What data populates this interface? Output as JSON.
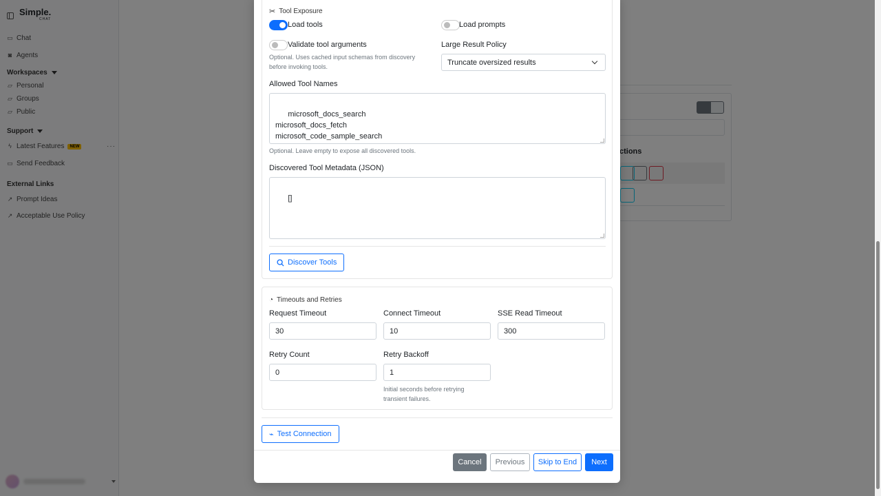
{
  "sidebar": {
    "brand": "Simple.",
    "brand_sub": "CHAT",
    "items": {
      "chat": "Chat",
      "agents": "Agents",
      "workspaces": "Workspaces",
      "personal": "Personal",
      "groups": "Groups",
      "public": "Public",
      "support": "Support",
      "latest_features": "Latest Features",
      "new_badge": "NEW",
      "send_feedback": "Send Feedback",
      "external_links": "External Links",
      "prompt_ideas": "Prompt Ideas",
      "acceptable_use": "Acceptable Use Policy"
    }
  },
  "background": {
    "actions_heading": "ctions"
  },
  "modal": {
    "tool_exposure": {
      "title": "Tool Exposure",
      "load_tools": {
        "label": "Load tools",
        "checked": true
      },
      "load_prompts": {
        "label": "Load prompts",
        "checked": false
      },
      "validate_args": {
        "label": "Validate tool arguments",
        "checked": false
      },
      "validate_help": "Optional. Uses cached input schemas from discovery before invoking tools.",
      "large_result_label": "Large Result Policy",
      "large_result_value": "Truncate oversized results",
      "allowed_label": "Allowed Tool Names",
      "allowed_value": "microsoft_docs_search\nmicrosoft_docs_fetch\nmicrosoft_code_sample_search",
      "allowed_help": "Optional. Leave empty to expose all discovered tools.",
      "metadata_label": "Discovered Tool Metadata (JSON)",
      "metadata_value": "[]",
      "discover_button": "Discover Tools"
    },
    "timeouts": {
      "title": "Timeouts and Retries",
      "request_timeout_label": "Request Timeout",
      "request_timeout_value": "30",
      "connect_timeout_label": "Connect Timeout",
      "connect_timeout_value": "10",
      "sse_timeout_label": "SSE Read Timeout",
      "sse_timeout_value": "300",
      "retry_count_label": "Retry Count",
      "retry_count_value": "0",
      "retry_backoff_label": "Retry Backoff",
      "retry_backoff_value": "1",
      "retry_backoff_help": "Initial seconds before retrying transient failures."
    },
    "test_connection": "Test Connection",
    "footer": {
      "cancel": "Cancel",
      "previous": "Previous",
      "skip": "Skip to End",
      "next": "Next"
    }
  },
  "colors": {
    "primary": "#0d6efd",
    "secondary": "#6c757d",
    "danger": "#dc3545",
    "info": "#0dcaf0",
    "badge": "#ffc107"
  }
}
